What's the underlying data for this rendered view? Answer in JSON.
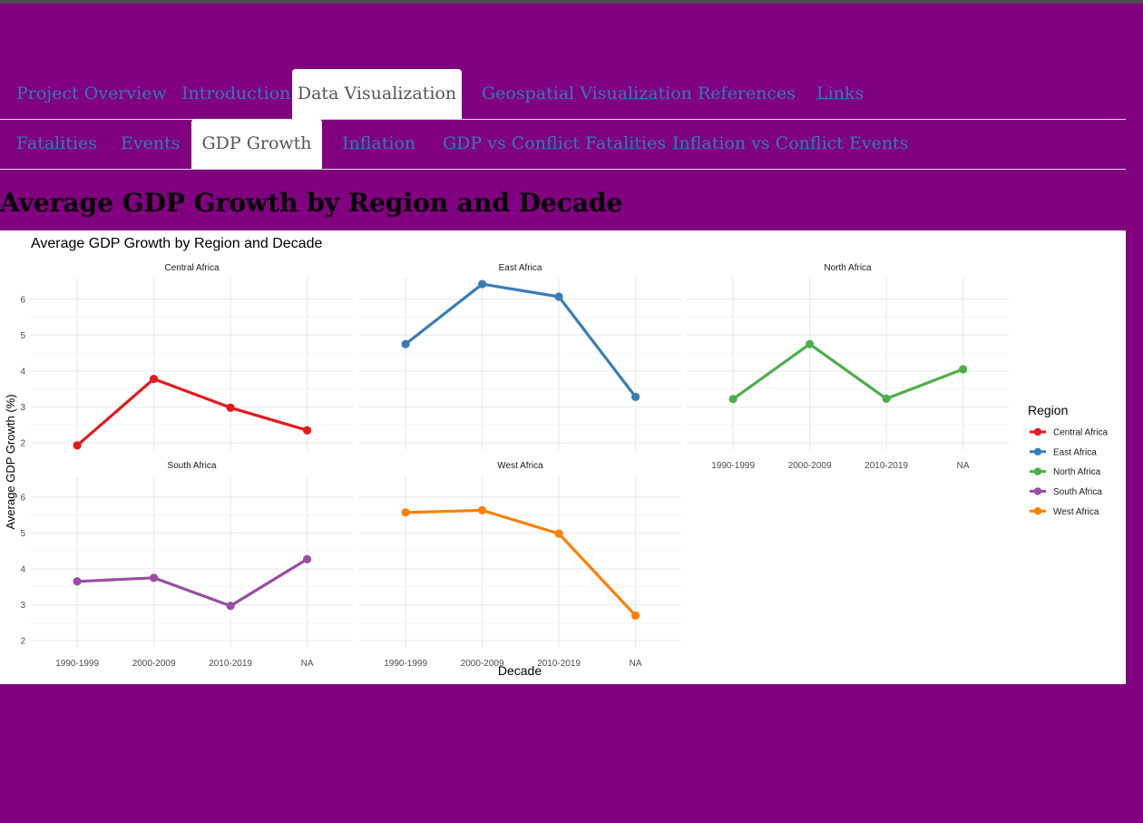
{
  "nav": {
    "main_tabs": [
      "Project Overview",
      "Introduction",
      "Data Visualization",
      "Geospatial Visualization",
      "References",
      "Links"
    ],
    "main_active": 2,
    "sub_tabs": [
      "Fatalities",
      "Events",
      "GDP Growth",
      "Inflation",
      "GDP vs Conflict Fatalities",
      "Inflation vs Conflict Events"
    ],
    "sub_active": 2
  },
  "page": {
    "title": "Average GDP Growth by Region and Decade"
  },
  "colors": {
    "background": "#800080",
    "tab_link": "#337ab7",
    "Central Africa": "#e41a1c",
    "East Africa": "#377eb8",
    "North Africa": "#4daf4a",
    "South Africa": "#984ea3",
    "West Africa": "#ff7f00"
  },
  "chart_data": {
    "type": "line",
    "title": "Average GDP Growth by Region and Decade",
    "xlabel": "Decade",
    "ylabel": "Average GDP Growth (%)",
    "categories": [
      "1990-1999",
      "2000-2009",
      "2010-2019",
      "NA"
    ],
    "ylim": [
      1.8,
      6.6
    ],
    "yticks": [
      2,
      3,
      4,
      5,
      6
    ],
    "grid": true,
    "legend_title": "Region",
    "legend_position": "right",
    "facet_layout": "3 columns, 2 rows",
    "series": [
      {
        "name": "Central Africa",
        "values": [
          1.93,
          3.78,
          2.98,
          2.35
        ]
      },
      {
        "name": "East Africa",
        "values": [
          4.75,
          6.42,
          6.07,
          3.28
        ]
      },
      {
        "name": "North Africa",
        "values": [
          3.22,
          4.75,
          3.23,
          4.05
        ]
      },
      {
        "name": "South Africa",
        "values": [
          3.65,
          3.75,
          2.97,
          4.27
        ]
      },
      {
        "name": "West Africa",
        "values": [
          5.57,
          5.63,
          4.98,
          2.7
        ]
      }
    ]
  }
}
